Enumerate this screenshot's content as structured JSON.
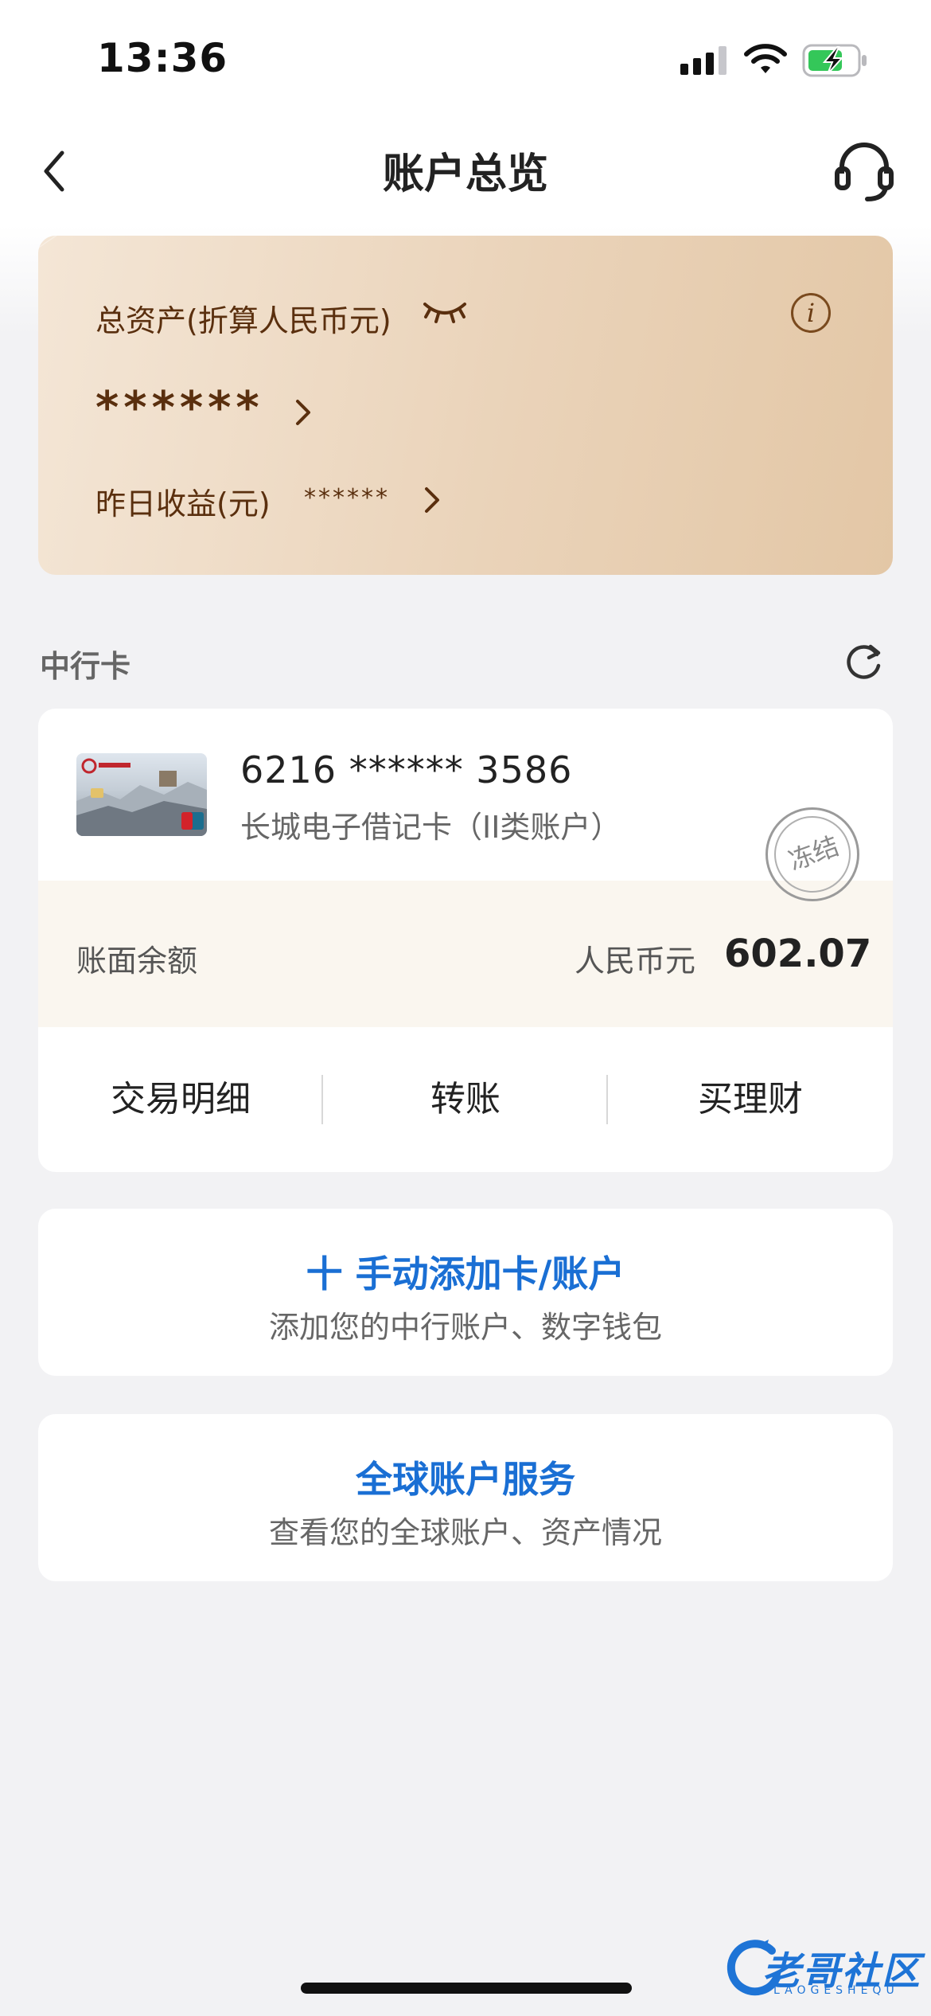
{
  "status_bar": {
    "time": "13:36"
  },
  "nav": {
    "title": "账户总览"
  },
  "assets": {
    "label": "总资产(折算人民币元)",
    "value": "******",
    "yield_label": "昨日收益(元)",
    "yield_value": "******",
    "info_glyph": "i"
  },
  "section": {
    "title": "中行卡"
  },
  "card": {
    "number": "6216 ****** 3586",
    "type": "长城电子借记卡（II类账户）",
    "status_stamp": "冻结",
    "balance_label": "账面余额",
    "currency": "人民币元",
    "balance": "602.07",
    "actions": [
      "交易明细",
      "转账",
      "买理财"
    ]
  },
  "add_card": {
    "title": "十 手动添加卡/账户",
    "subtitle": "添加您的中行账户、数字钱包"
  },
  "global": {
    "title": "全球账户服务",
    "subtitle": "查看您的全球账户、资产情况"
  },
  "watermark": {
    "text": "老哥社区",
    "sub": "LAOGESHEQU"
  },
  "colors": {
    "accent_blue": "#1a6fd4",
    "asset_brown": "#5a2f0e",
    "battery_green": "#34c759"
  },
  "icons": [
    "back-chevron-icon",
    "headset-icon",
    "eye-closed-icon",
    "info-icon",
    "chevron-right-icon",
    "refresh-icon",
    "signal-icon",
    "wifi-icon",
    "battery-charging-icon"
  ]
}
